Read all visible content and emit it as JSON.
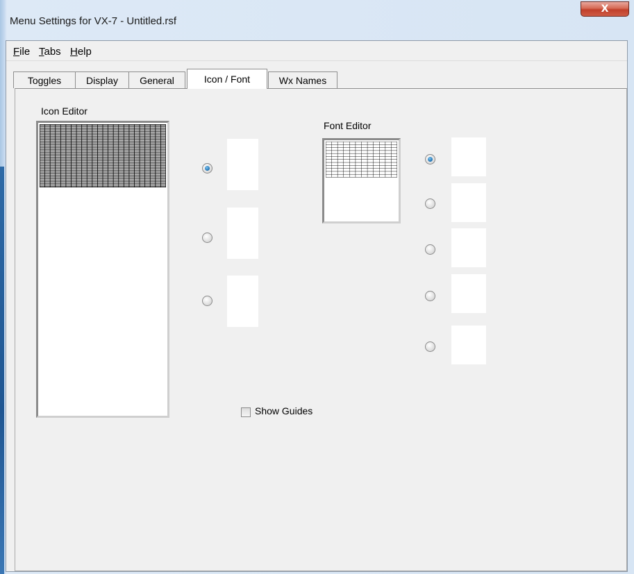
{
  "window": {
    "title": "Menu Settings for VX-7 - Untitled.rsf",
    "close_glyph": "X"
  },
  "menubar": {
    "items": [
      {
        "label": "File",
        "accel": "F",
        "rest": "ile"
      },
      {
        "label": "Tabs",
        "accel": "T",
        "rest": "abs"
      },
      {
        "label": "Help",
        "accel": "H",
        "rest": "elp"
      }
    ]
  },
  "tabs": [
    {
      "label": "Toggles",
      "active": false
    },
    {
      "label": "Display",
      "active": false
    },
    {
      "label": "General",
      "active": false
    },
    {
      "label": "Icon / Font",
      "active": true
    },
    {
      "label": "Wx Names",
      "active": false
    }
  ],
  "icon_editor": {
    "label": "Icon Editor",
    "grid_cols": 24,
    "grid_rows": 52,
    "options": [
      {
        "checked": true
      },
      {
        "checked": false
      },
      {
        "checked": false
      }
    ]
  },
  "font_editor": {
    "label": "Font Editor",
    "grid_cols": 12,
    "grid_rows": 12,
    "options": [
      {
        "checked": true
      },
      {
        "checked": false
      },
      {
        "checked": false
      },
      {
        "checked": false
      },
      {
        "checked": false
      }
    ]
  },
  "show_guides": {
    "label": "Show Guides",
    "checked": false
  },
  "icons": {
    "close": "close-icon",
    "radio": "radio-button-icon",
    "checkbox": "checkbox-icon"
  },
  "colors": {
    "title_bar": "#dde9f6",
    "close_button": "#c0402b",
    "radio_checked": "#1b6fb0",
    "panel_bg": "#f0f0f0"
  }
}
